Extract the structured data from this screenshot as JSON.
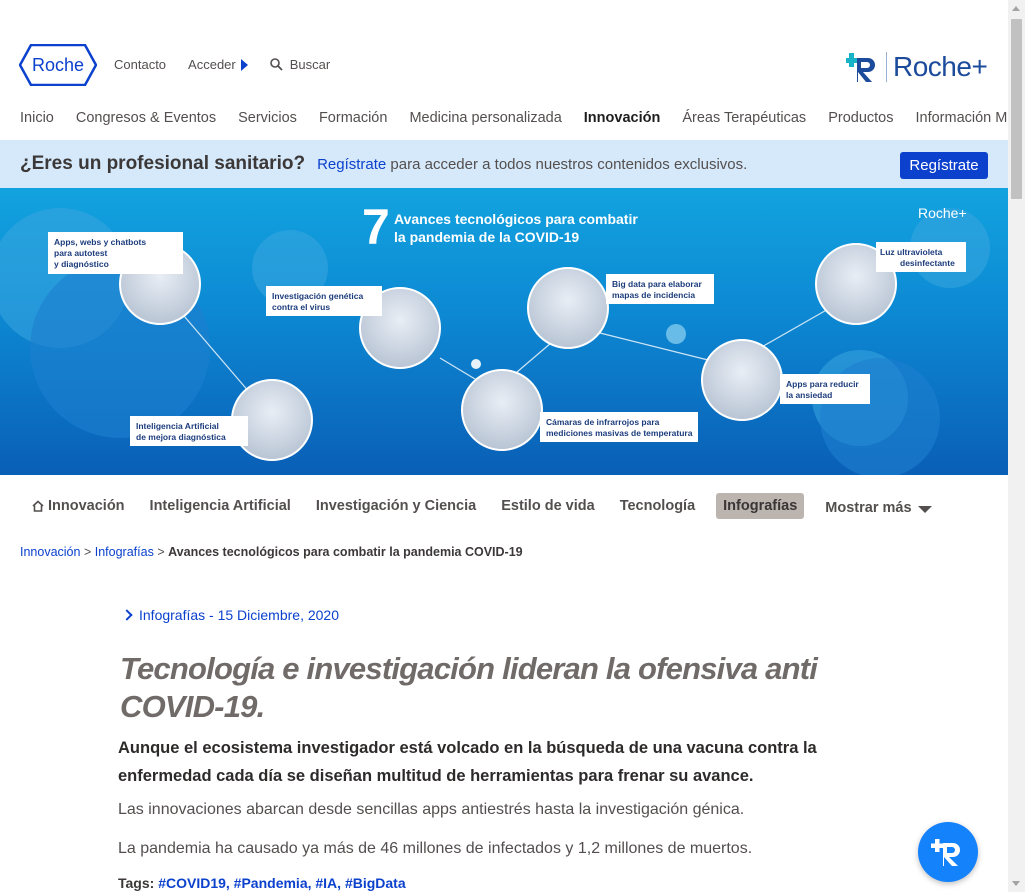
{
  "header": {
    "logo_text": "Roche",
    "contact": "Contacto",
    "login": "Acceder",
    "search_placeholder": "Buscar",
    "brand_plus": "Roche+"
  },
  "main_nav": [
    {
      "label": "Inicio",
      "active": false
    },
    {
      "label": "Congresos & Eventos",
      "active": false
    },
    {
      "label": "Servicios",
      "active": false
    },
    {
      "label": "Formación",
      "active": false
    },
    {
      "label": "Medicina personalizada",
      "active": false
    },
    {
      "label": "Innovación",
      "active": true
    },
    {
      "label": "Áreas Terapéuticas",
      "active": false
    },
    {
      "label": "Productos",
      "active": false
    },
    {
      "label": "Información Médica",
      "active": false
    }
  ],
  "register_bar": {
    "question": "¿Eres un profesional sanitario?",
    "link": "Regístrate",
    "text": " para acceder a todos nuestros contenidos exclusivos.",
    "button": "Regístrate"
  },
  "hero": {
    "number": "7",
    "title_line1": "Avances tecnológicos para combatir",
    "title_line2": "la pandemia de la COVID-19",
    "brand": "Roche+",
    "labels": {
      "apps_l1": "Apps, webs y chatbots",
      "apps_l2": "para autotest",
      "apps_l3": "y diagnóstico",
      "gen_l1": "Investigación genética",
      "gen_l2": "contra el virus",
      "big_l1": "Big data para elaborar",
      "big_l2": "mapas de incidencia",
      "uv_l1": "Luz ultravioleta",
      "uv_l2": "desinfectante",
      "anx_l1": "Apps para reducir",
      "anx_l2": "la ansiedad",
      "ir_l1": "Cámaras de infrarrojos para",
      "ir_l2": "mediciones masivas de temperatura",
      "ai_l1": "Inteligencia Artificial",
      "ai_l2": "de mejora diagnóstica"
    }
  },
  "category_nav": {
    "items": [
      {
        "label": "Innovación",
        "home": true,
        "active": false
      },
      {
        "label": "Inteligencia Artificial",
        "active": false
      },
      {
        "label": "Investigación y Ciencia",
        "active": false
      },
      {
        "label": "Estilo de vida",
        "active": false
      },
      {
        "label": "Tecnología",
        "active": false
      },
      {
        "label": "Infografías",
        "active": true
      }
    ],
    "more": "Mostrar más"
  },
  "breadcrumb": {
    "items": [
      "Innovación",
      "Infografías"
    ],
    "separator": ">",
    "current": "Avances tecnológicos para combatir la pandemia COVID-19"
  },
  "article": {
    "meta": "Infografías - 15 Diciembre, 2020",
    "title": "Tecnología e investigación lideran la ofensiva anti COVID-19.",
    "lead": "Aunque el ecosistema investigador está volcado en la búsqueda de una vacuna contra la enfermedad cada día se diseñan multitud de herramientas para frenar su avance.",
    "p1": "Las innovaciones abarcan desde sencillas apps antiestrés hasta la investigación génica.",
    "p2": "La pandemia ha causado ya más de 46 millones de infectados y 1,2 millones de muertos.",
    "tags_label": "Tags:",
    "tags": "#COVID19, #Pandemia, #IA, #BigData"
  },
  "colors": {
    "brand_blue": "#0b41cd",
    "register_bg": "#d5e9fa",
    "active_tab_bg": "#bbb4af",
    "float_button": "#1482fa"
  }
}
